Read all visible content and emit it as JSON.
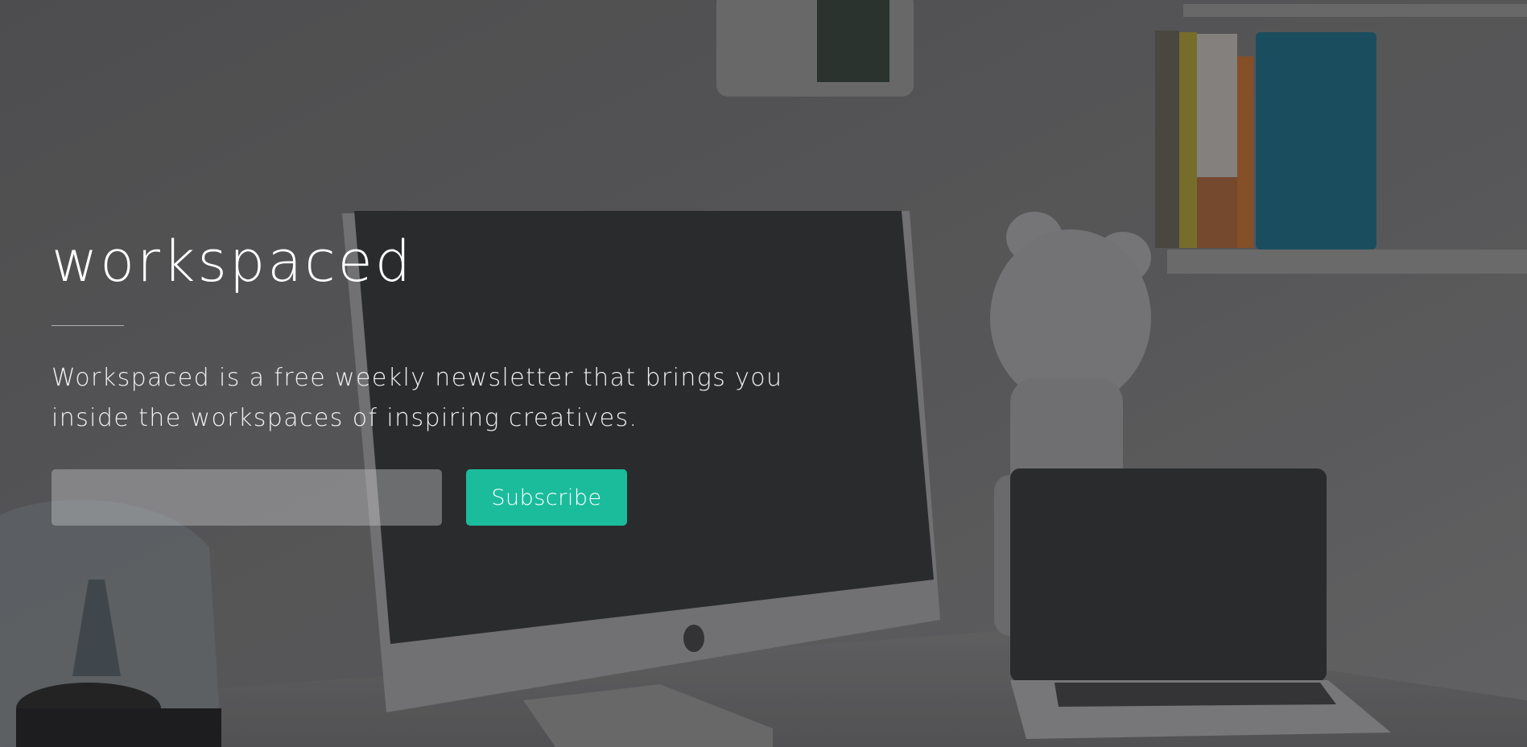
{
  "hero": {
    "title": "workspaced",
    "description_line1": "Workspaced is a free weekly newsletter that brings you",
    "description_line2": "inside the workspaces of inspiring creatives."
  },
  "form": {
    "email_value": "",
    "email_placeholder": "",
    "subscribe_label": "Subscribe"
  },
  "theme": {
    "accent": "#1abc9c",
    "text": "#ffffff"
  },
  "background": {
    "subject": "desk with iMac, laptop, bear figurine, books on shelf and lamp"
  }
}
